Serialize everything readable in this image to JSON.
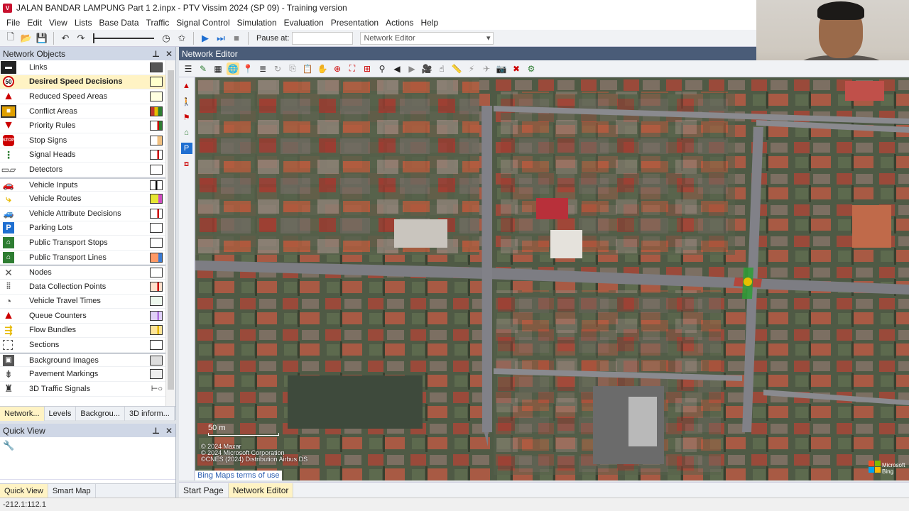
{
  "window": {
    "title": "JALAN BANDAR LAMPUNG Part 1 2.inpx - PTV Vissim 2024 (SP 09) - Training version"
  },
  "menu": [
    "File",
    "Edit",
    "View",
    "Lists",
    "Base Data",
    "Traffic",
    "Signal Control",
    "Simulation",
    "Evaluation",
    "Presentation",
    "Actions",
    "Help"
  ],
  "toolbar": {
    "pause_label": "Pause at:",
    "pause_value": "",
    "view_select": "Network Editor"
  },
  "network_objects": {
    "title": "Network Objects",
    "items": [
      {
        "label": "Links",
        "color": "#555555"
      },
      {
        "label": "Desired Speed Decisions",
        "color": "#ffffcc"
      },
      {
        "label": "Reduced Speed Areas",
        "color": "#ffffe0"
      },
      {
        "label": "Conflict Areas",
        "color": "#c0392b"
      },
      {
        "label": "Priority Rules",
        "color": "#2e7d32"
      },
      {
        "label": "Stop Signs",
        "color": "#f0c080"
      },
      {
        "label": "Signal Heads",
        "color": "#c00000"
      },
      {
        "label": "Detectors",
        "color": "#ffffff"
      },
      {
        "label": "Vehicle Inputs",
        "color": "#000000"
      },
      {
        "label": "Vehicle Routes",
        "color": "#e6e633"
      },
      {
        "label": "Vehicle Attribute Decisions",
        "color": "#ffcccc"
      },
      {
        "label": "Parking Lots",
        "color": "#ffffff"
      },
      {
        "label": "Public Transport Stops",
        "color": "#ffffff"
      },
      {
        "label": "Public Transport Lines",
        "color": "#ff9966"
      },
      {
        "label": "Nodes",
        "color": "#ffffff"
      },
      {
        "label": "Data Collection Points",
        "color": "#ffe0cc"
      },
      {
        "label": "Vehicle Travel Times",
        "color": "#eef8ee"
      },
      {
        "label": "Queue Counters",
        "color": "#e0d0f8"
      },
      {
        "label": "Flow Bundles",
        "color": "#ffe599"
      },
      {
        "label": "Sections",
        "color": "#ffffff"
      },
      {
        "label": "Background Images",
        "color": "#dddddd"
      },
      {
        "label": "Pavement Markings",
        "color": "#eeeeee"
      },
      {
        "label": "3D Traffic Signals",
        "color": "#ffffff"
      }
    ],
    "tabs": [
      "Network...",
      "Levels",
      "Backgrou...",
      "3D inform..."
    ]
  },
  "quick_view": {
    "title": "Quick View",
    "tabs": [
      "Quick View",
      "Smart Map"
    ]
  },
  "editor": {
    "title": "Network Editor",
    "scale_label": "50 m",
    "copyright": [
      "© 2024 Maxar",
      "© 2024 Microsoft Corporation",
      "©CNES (2024) Distribution Airbus DS"
    ],
    "bing_link": "Bing Maps terms of use",
    "logo_text": [
      "Microsoft",
      "Bing"
    ],
    "tabs": [
      "Start Page",
      "Network Editor"
    ]
  },
  "status": {
    "coords": "-212.1:112.1"
  }
}
